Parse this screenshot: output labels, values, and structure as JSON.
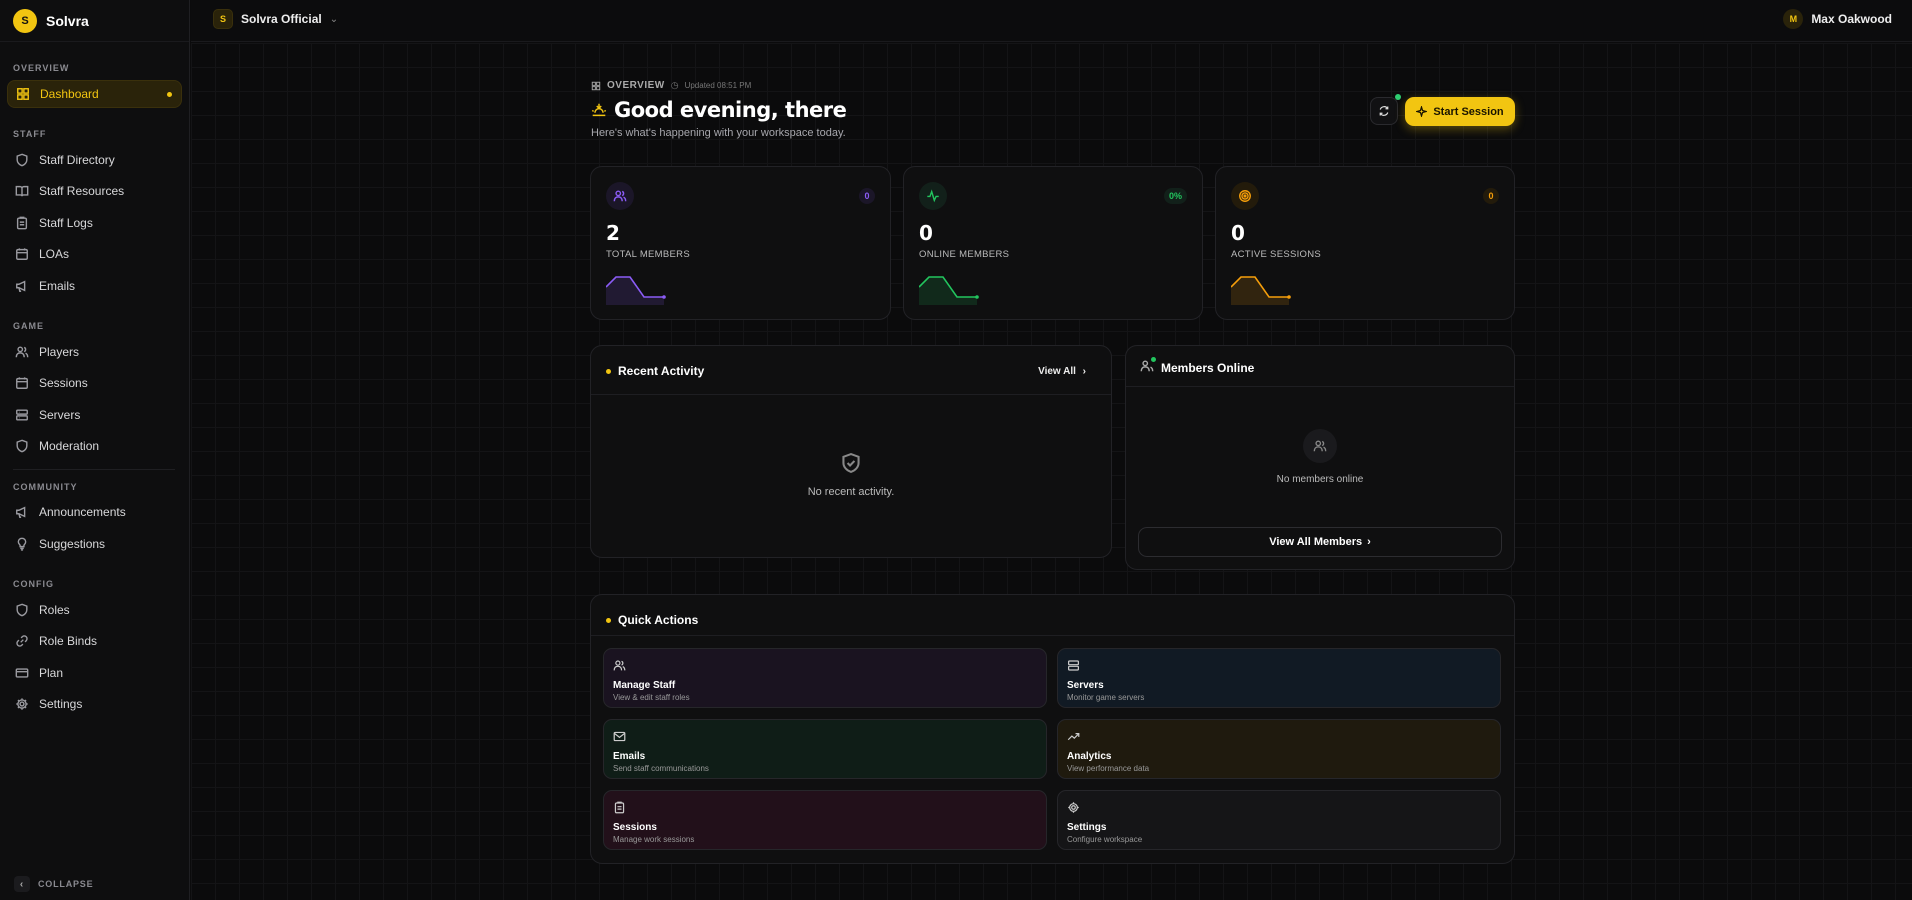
{
  "brand": {
    "name": "Solvra",
    "logo_letter": "S"
  },
  "sidebar": {
    "sections": [
      {
        "label": "OVERVIEW",
        "items": [
          {
            "label": "Dashboard",
            "icon": "dashboard-icon",
            "active": true
          }
        ]
      },
      {
        "label": "STAFF",
        "items": [
          {
            "label": "Staff Directory",
            "icon": "shield-icon"
          },
          {
            "label": "Staff Resources",
            "icon": "book-icon"
          },
          {
            "label": "Staff Logs",
            "icon": "clipboard-icon"
          },
          {
            "label": "LOAs",
            "icon": "calendar-icon"
          },
          {
            "label": "Emails",
            "icon": "megaphone-icon"
          }
        ]
      },
      {
        "label": "GAME",
        "items": [
          {
            "label": "Players",
            "icon": "users-icon"
          },
          {
            "label": "Sessions",
            "icon": "calendar-icon"
          },
          {
            "label": "Servers",
            "icon": "server-icon"
          },
          {
            "label": "Moderation",
            "icon": "shield-icon"
          }
        ]
      },
      {
        "label": "COMMUNITY",
        "items": [
          {
            "label": "Announcements",
            "icon": "megaphone-icon"
          },
          {
            "label": "Suggestions",
            "icon": "lightbulb-icon"
          }
        ]
      },
      {
        "label": "CONFIG",
        "items": [
          {
            "label": "Roles",
            "icon": "shield-icon"
          },
          {
            "label": "Role Binds",
            "icon": "link-icon"
          },
          {
            "label": "Plan",
            "icon": "card-icon"
          },
          {
            "label": "Settings",
            "icon": "gear-icon"
          }
        ]
      }
    ],
    "collapse_label": "COLLAPSE"
  },
  "topbar": {
    "workspace": {
      "badge": "S",
      "name": "Solvra Official"
    },
    "user": {
      "initial": "M",
      "name": "Max Oakwood"
    }
  },
  "overview": {
    "label": "OVERVIEW",
    "updated": "Updated 08:51 PM",
    "greeting": "Good evening, there",
    "subtitle": "Here's what's happening with your workspace today.",
    "start_session_label": "Start Session"
  },
  "stats": [
    {
      "value": "2",
      "label": "TOTAL MEMBERS",
      "badge": "0",
      "color": "#8b5cf6",
      "icon": "users-icon"
    },
    {
      "value": "0",
      "label": "ONLINE MEMBERS",
      "badge": "0%",
      "color": "#22c55e",
      "icon": "activity-icon"
    },
    {
      "value": "0",
      "label": "ACTIVE SESSIONS",
      "badge": "0",
      "color": "#f59e0b",
      "icon": "target-icon"
    }
  ],
  "recent_activity": {
    "title": "Recent Activity",
    "view_all": "View All",
    "empty_text": "No recent activity."
  },
  "members_online": {
    "title": "Members Online",
    "empty_text": "No members online",
    "view_all": "View All Members"
  },
  "quick_actions": {
    "title": "Quick Actions",
    "items": [
      {
        "title": "Manage Staff",
        "desc": "View & edit staff roles",
        "icon": "users-icon",
        "color": "#1a1320"
      },
      {
        "title": "Servers",
        "desc": "Monitor game servers",
        "icon": "server-icon",
        "color": "#111a24"
      },
      {
        "title": "Emails",
        "desc": "Send staff communications",
        "icon": "mail-icon",
        "color": "#0f1d17"
      },
      {
        "title": "Analytics",
        "desc": "View performance data",
        "icon": "trending-icon",
        "color": "#1f1a0e"
      },
      {
        "title": "Sessions",
        "desc": "Manage work sessions",
        "icon": "clipboard-icon",
        "color": "#22101a"
      },
      {
        "title": "Settings",
        "desc": "Configure workspace",
        "icon": "gear-icon",
        "color": "#151517"
      }
    ]
  }
}
